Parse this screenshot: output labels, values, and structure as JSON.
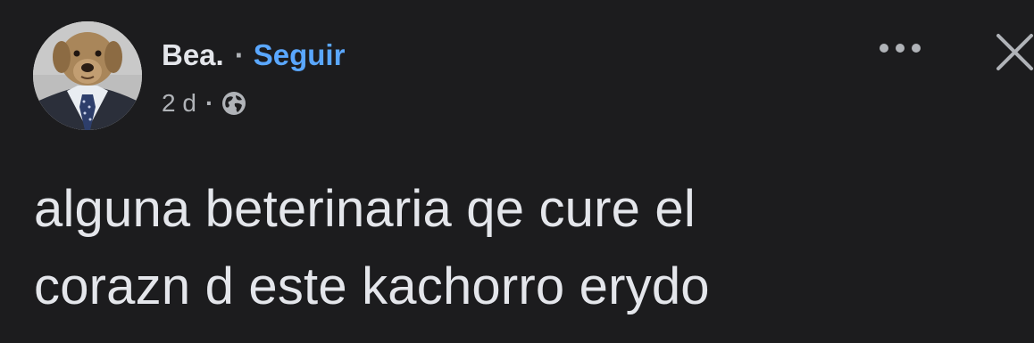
{
  "post": {
    "author": {
      "name": "Bea.",
      "separator": "·",
      "follow_label": "Seguir"
    },
    "meta": {
      "time": "2 d",
      "separator": "·",
      "audience_icon": "globe-icon"
    },
    "actions": {
      "more_icon": "more-dots-icon",
      "close_icon": "close-icon"
    },
    "text_lines": [
      "alguna beterinaria qe cure el",
      "corazn d este kachorro erydo"
    ]
  },
  "colors": {
    "background": "#1c1c1e",
    "text_primary": "#e4e6eb",
    "text_secondary": "#b0b3b8",
    "link": "#5aa7ff"
  }
}
